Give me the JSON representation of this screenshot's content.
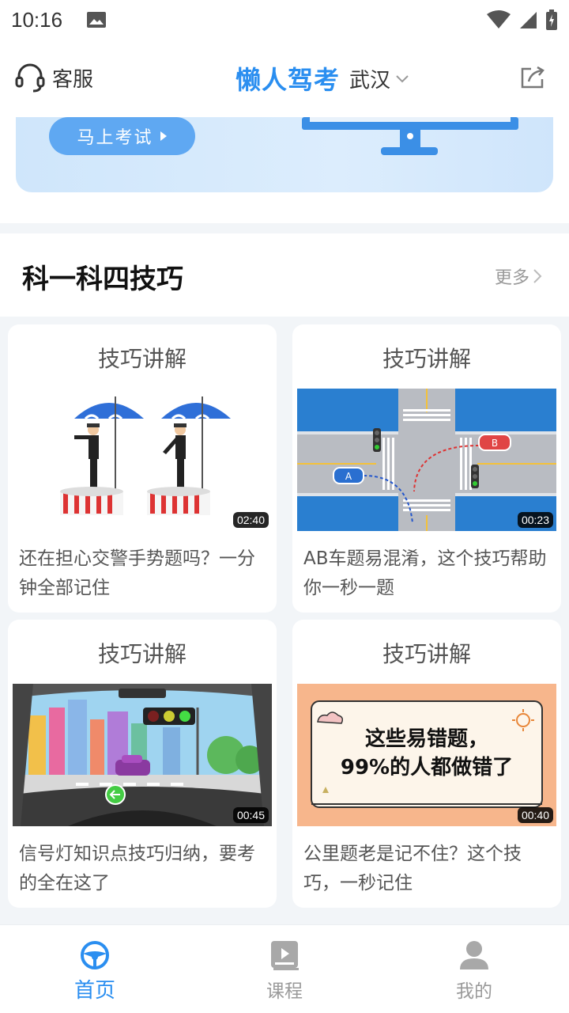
{
  "status_bar": {
    "time": "10:16"
  },
  "header": {
    "service_label": "客服",
    "brand": "懒人驾考",
    "city": "武汉"
  },
  "banner": {
    "exam_button_label": "马上考试"
  },
  "section": {
    "title": "科一科四技巧",
    "more_label": "更多"
  },
  "cards": [
    {
      "title": "技巧讲解",
      "duration": "02:40",
      "desc": "还在担心交警手势题吗？一分钟全部记住",
      "thumb": "traffic-police-gestures"
    },
    {
      "title": "技巧讲解",
      "duration": "00:23",
      "desc": "AB车题易混淆，这个技巧帮助你一秒一题",
      "thumb": "ab-car-intersection"
    },
    {
      "title": "技巧讲解",
      "duration": "00:45",
      "desc": "信号灯知识点技巧归纳，要考的全在这了",
      "thumb": "traffic-light-windshield"
    },
    {
      "title": "技巧讲解",
      "duration": "00:40",
      "desc": "公里题老是记不住？这个技巧，一秒记住",
      "thumb": "easy-mistakes-board",
      "thumb_text_1": "这些易错题，",
      "thumb_text_2": "99%的人都做错了"
    }
  ],
  "thumb_labels": {
    "car_a": "A",
    "car_b": "B"
  },
  "bottom_nav": [
    {
      "label": "首页",
      "icon": "steering-wheel-icon",
      "active": true
    },
    {
      "label": "课程",
      "icon": "course-video-icon",
      "active": false
    },
    {
      "label": "我的",
      "icon": "profile-icon",
      "active": false
    }
  ],
  "colors": {
    "accent": "#2a8ef0",
    "banner_button": "#5fa8f2",
    "background": "#f2f5f8"
  }
}
